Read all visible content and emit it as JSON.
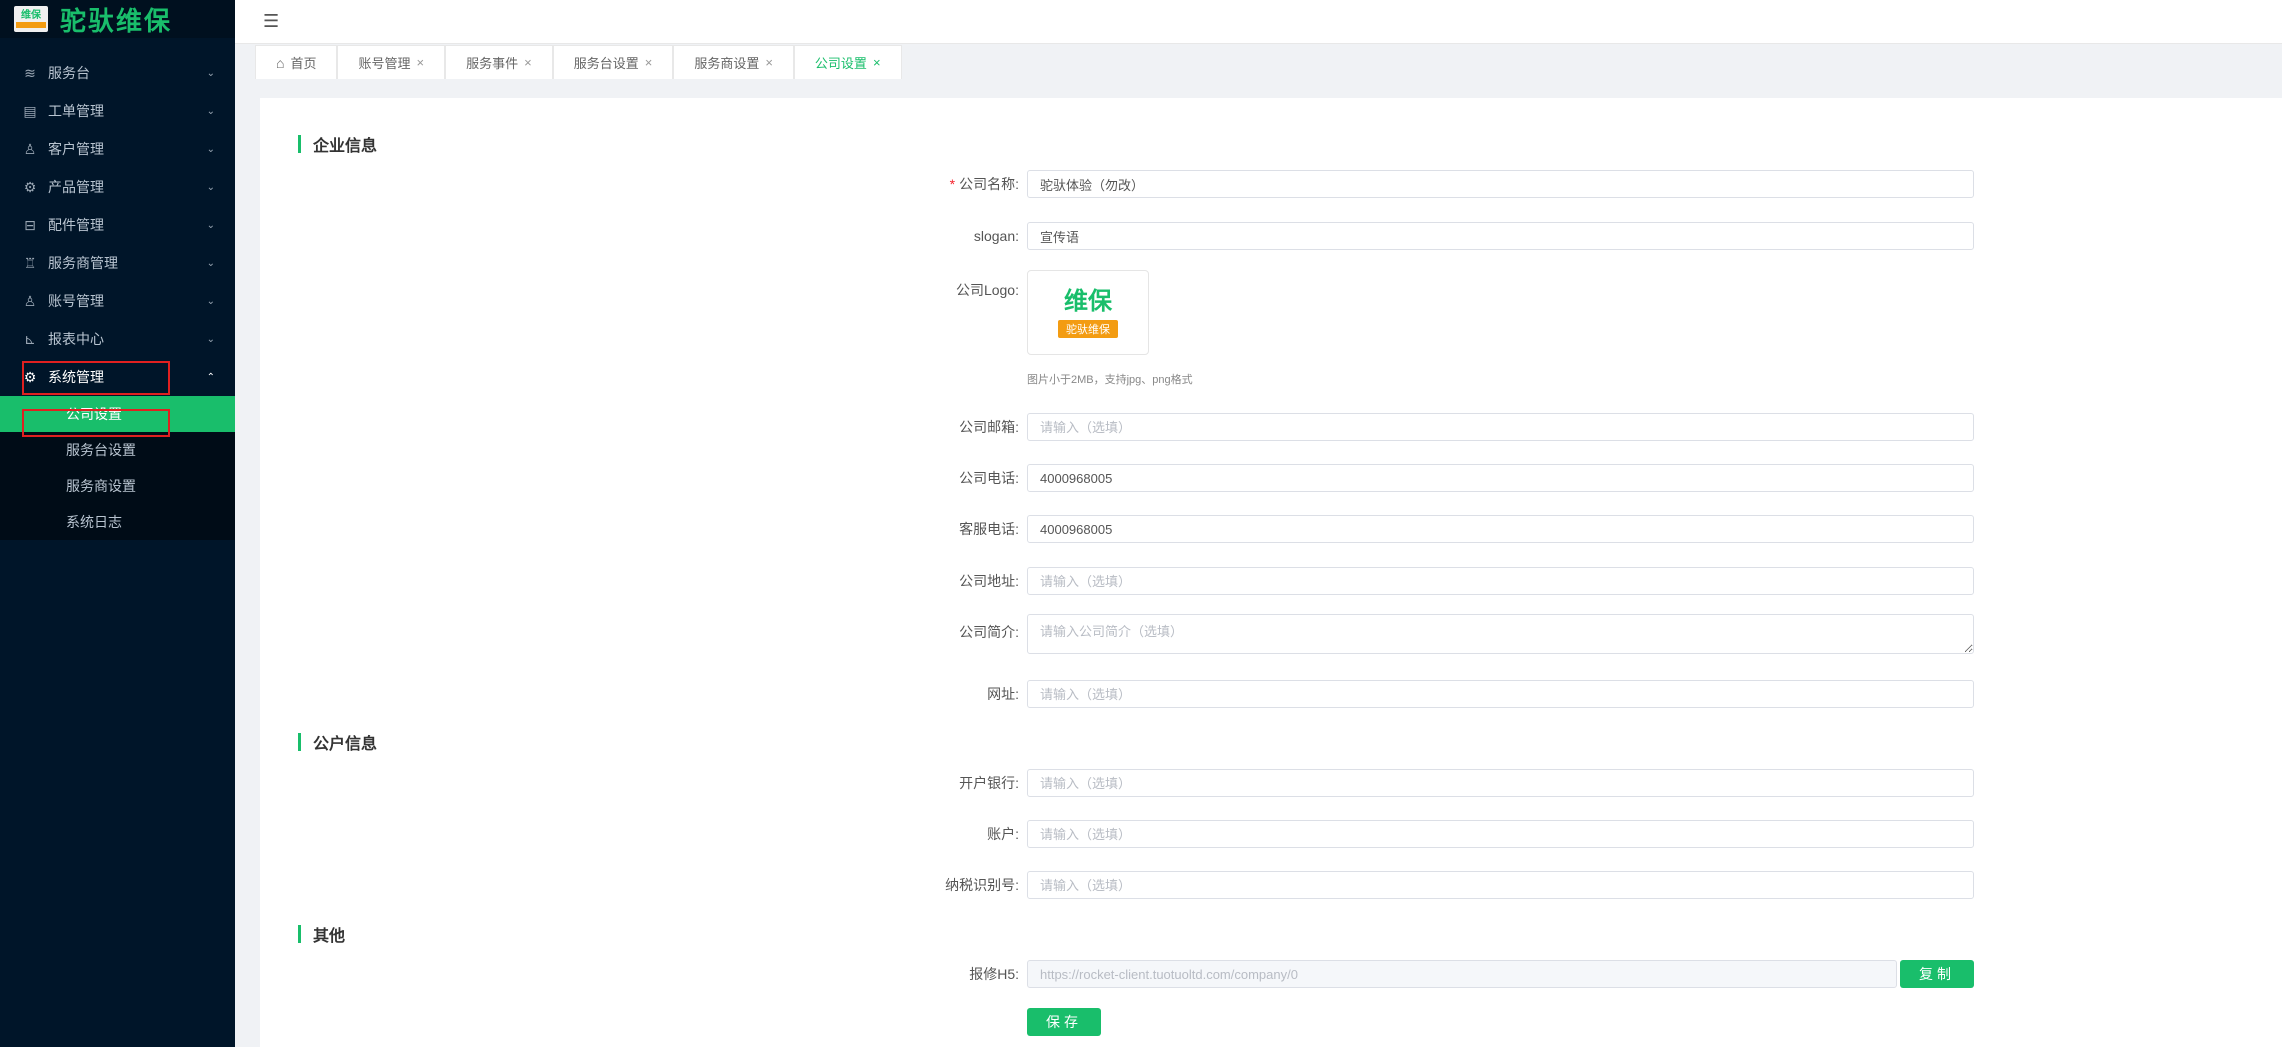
{
  "logo": {
    "badge_text": "维保",
    "brand_text": "驼驮维保"
  },
  "sidebar": {
    "items": [
      {
        "label": "服务台",
        "icon": "≋"
      },
      {
        "label": "工单管理",
        "icon": "▤"
      },
      {
        "label": "客户管理",
        "icon": "♙"
      },
      {
        "label": "产品管理",
        "icon": "⚙"
      },
      {
        "label": "配件管理",
        "icon": "⊟"
      },
      {
        "label": "服务商管理",
        "icon": "♖"
      },
      {
        "label": "账号管理",
        "icon": "♙"
      },
      {
        "label": "报表中心",
        "icon": "⊾"
      },
      {
        "label": "系统管理",
        "icon": "⚙"
      }
    ],
    "submenu": [
      {
        "label": "公司设置"
      },
      {
        "label": "服务台设置"
      },
      {
        "label": "服务商设置"
      },
      {
        "label": "系统日志"
      }
    ]
  },
  "topbar": {
    "menu_icon": "☰"
  },
  "tabs": [
    {
      "label": "首页"
    },
    {
      "label": "账号管理"
    },
    {
      "label": "服务事件"
    },
    {
      "label": "服务台设置"
    },
    {
      "label": "服务商设置"
    },
    {
      "label": "公司设置"
    }
  ],
  "tab_close": "×",
  "sections": {
    "company": "企业信息",
    "account": "公户信息",
    "other": "其他"
  },
  "form": {
    "company_name": {
      "label": "公司名称:",
      "value": "驼驮体验（勿改）"
    },
    "slogan": {
      "label": "slogan:",
      "value": "宣传语"
    },
    "logo": {
      "label": "公司Logo:",
      "img_top": "维保",
      "img_bottom": "驼驮维保",
      "hint": "图片小于2MB，支持jpg、png格式"
    },
    "email": {
      "label": "公司邮箱:",
      "placeholder": "请输入（选填）"
    },
    "phone": {
      "label": "公司电话:",
      "value": "4000968005"
    },
    "service_phone": {
      "label": "客服电话:",
      "value": "4000968005"
    },
    "address": {
      "label": "公司地址:",
      "placeholder": "请输入（选填）"
    },
    "intro": {
      "label": "公司简介:",
      "placeholder": "请输入公司简介（选填）"
    },
    "website": {
      "label": "网址:",
      "placeholder": "请输入（选填）"
    },
    "bank": {
      "label": "开户银行:",
      "placeholder": "请输入（选填）"
    },
    "account_no": {
      "label": "账户:",
      "placeholder": "请输入（选填）"
    },
    "tax_id": {
      "label": "纳税识别号:",
      "placeholder": "请输入（选填）"
    },
    "h5": {
      "label": "报修H5:",
      "value": "https://rocket-client.tuotuoltd.com/company/0"
    },
    "copy_button": "复制",
    "save_button": "保存"
  }
}
